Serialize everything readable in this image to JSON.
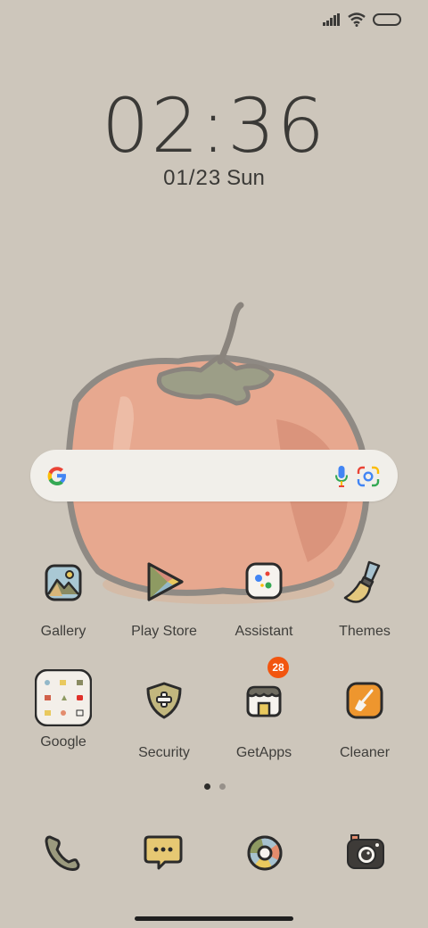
{
  "status_bar": {
    "signal_icon": "signal-icon",
    "wifi_icon": "wifi-icon",
    "battery_icon": "battery-icon"
  },
  "clock": {
    "time": "02:36",
    "date": "01/23",
    "weekday": "Sun"
  },
  "search_bar": {
    "google_icon": "google-g-icon",
    "mic_icon": "mic-icon",
    "lens_icon": "lens-icon"
  },
  "apps_row1": [
    {
      "label": "Gallery"
    },
    {
      "label": "Play Store"
    },
    {
      "label": "Assistant"
    },
    {
      "label": "Themes"
    }
  ],
  "apps_row2": [
    {
      "label": "Google"
    },
    {
      "label": "Security"
    },
    {
      "label": "GetApps",
      "badge": "28"
    },
    {
      "label": "Cleaner"
    }
  ],
  "dock": [
    {
      "icon": "phone-icon"
    },
    {
      "icon": "messages-icon"
    },
    {
      "icon": "browser-icon"
    },
    {
      "icon": "camera-icon"
    }
  ],
  "page_indicator": {
    "pages": 2,
    "current": 1
  },
  "colors": {
    "background": "#cdc6bb",
    "badge": "#f2550f",
    "text": "#3b3a38"
  }
}
